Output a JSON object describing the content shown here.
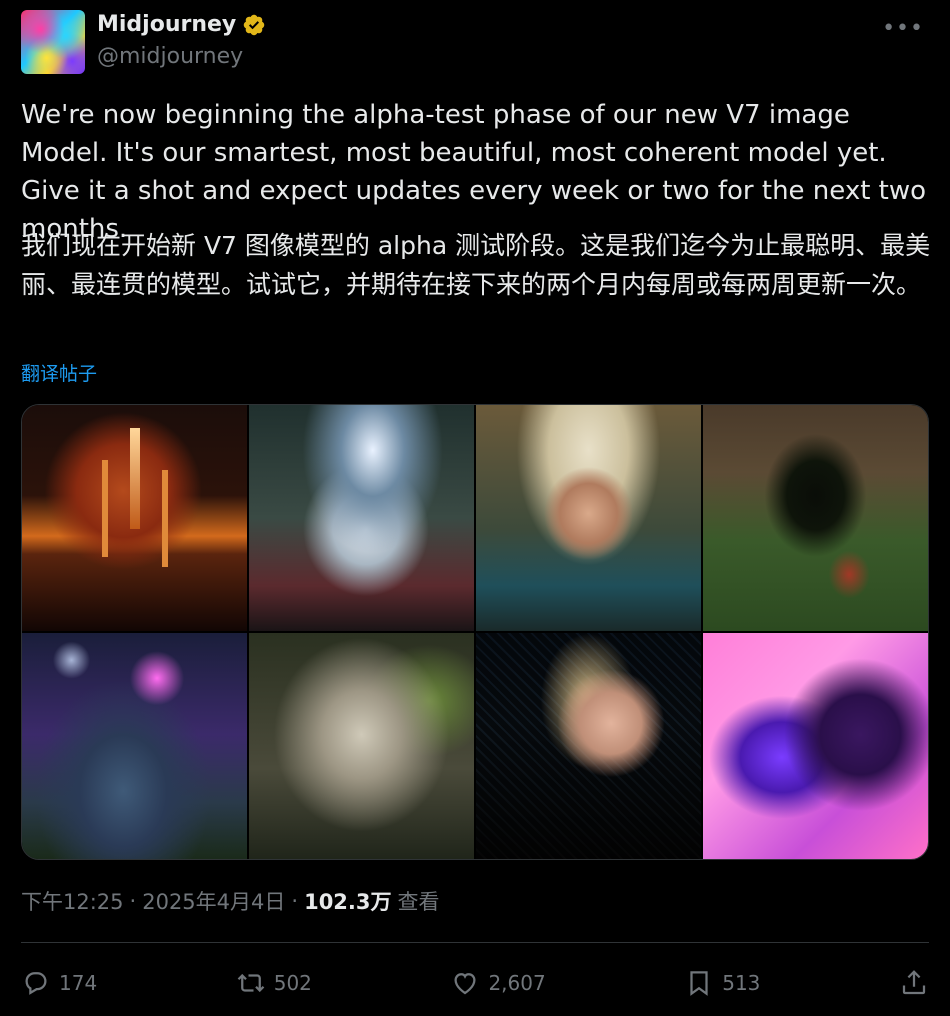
{
  "author": {
    "name": "Midjourney",
    "handle": "@midjourney",
    "verified_color": "#e2b719"
  },
  "tweet": {
    "text_en": "We're now beginning the alpha-test phase of our new V7 image Model. It's our smartest, most beautiful, most coherent model yet. Give it a shot and expect updates every week or two for the next two months.",
    "text_zh": "我们现在开始新 V7 图像模型的 alpha 测试阶段。这是我们迄今为止最聪明、最美丽、最连贯的模型。试试它，并期待在接下来的两个月内每周或每两周更新一次。",
    "translate_link": "翻译帖子"
  },
  "media": [
    {
      "name": "image-1"
    },
    {
      "name": "image-2"
    },
    {
      "name": "image-3"
    },
    {
      "name": "image-4"
    },
    {
      "name": "image-5"
    },
    {
      "name": "image-6"
    },
    {
      "name": "image-7"
    },
    {
      "name": "image-8"
    }
  ],
  "meta": {
    "time": "下午12:25",
    "separator": "·",
    "date": "2025年4月4日",
    "views_count": "102.3万",
    "views_label": "查看"
  },
  "actions": {
    "replies": "174",
    "reposts": "502",
    "likes": "2,607",
    "bookmarks": "513"
  },
  "colors": {
    "background": "#000000",
    "text": "#e7e9ea",
    "muted": "#71767b",
    "link": "#1d9bf0",
    "border": "#2f3336"
  }
}
